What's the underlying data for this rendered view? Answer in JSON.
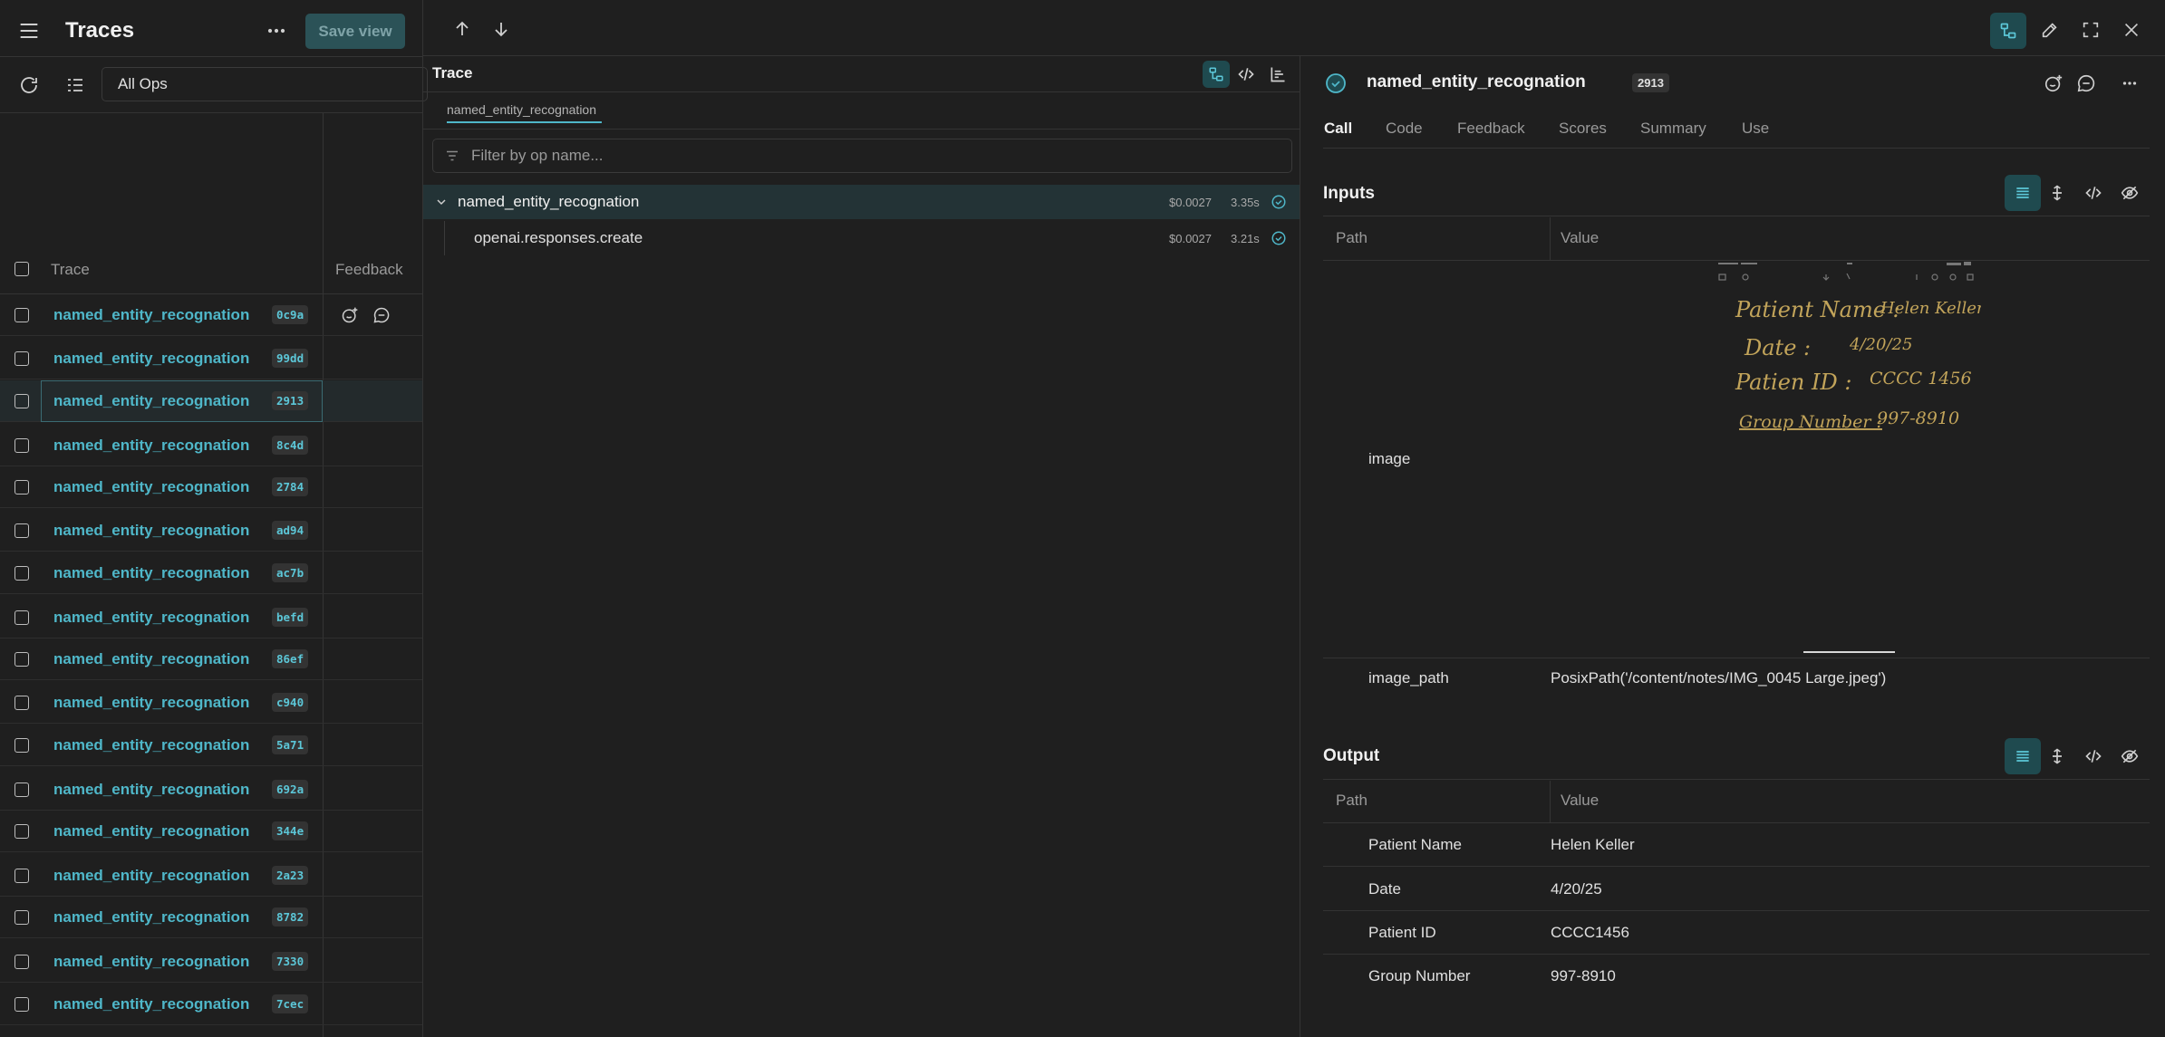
{
  "left": {
    "title": "Traces",
    "save_view": "Save view",
    "filter_select": "All Ops",
    "columns": {
      "trace": "Trace",
      "feedback": "Feedback"
    },
    "rows": [
      {
        "name": "named_entity_recognation",
        "id": "0c9a"
      },
      {
        "name": "named_entity_recognation",
        "id": "99dd"
      },
      {
        "name": "named_entity_recognation",
        "id": "2913"
      },
      {
        "name": "named_entity_recognation",
        "id": "8c4d"
      },
      {
        "name": "named_entity_recognation",
        "id": "2784"
      },
      {
        "name": "named_entity_recognation",
        "id": "ad94"
      },
      {
        "name": "named_entity_recognation",
        "id": "ac7b"
      },
      {
        "name": "named_entity_recognation",
        "id": "befd"
      },
      {
        "name": "named_entity_recognation",
        "id": "86ef"
      },
      {
        "name": "named_entity_recognation",
        "id": "c940"
      },
      {
        "name": "named_entity_recognation",
        "id": "5a71"
      },
      {
        "name": "named_entity_recognation",
        "id": "692a"
      },
      {
        "name": "named_entity_recognation",
        "id": "344e"
      },
      {
        "name": "named_entity_recognation",
        "id": "2a23"
      },
      {
        "name": "named_entity_recognation",
        "id": "8782"
      },
      {
        "name": "named_entity_recognation",
        "id": "7330"
      },
      {
        "name": "named_entity_recognation",
        "id": "7cec"
      }
    ]
  },
  "middle": {
    "title": "Trace",
    "breadcrumb": "named_entity_recognation",
    "filter_placeholder": "Filter by op name...",
    "tree": [
      {
        "name": "named_entity_recognation",
        "cost": "$0.0027",
        "time": "3.35s"
      },
      {
        "name": "openai.responses.create",
        "cost": "$0.0027",
        "time": "3.21s"
      }
    ]
  },
  "right": {
    "call_name": "named_entity_recognation",
    "call_id": "2913",
    "tabs": [
      "Call",
      "Code",
      "Feedback",
      "Scores",
      "Summary",
      "Use"
    ],
    "inputs": {
      "title": "Inputs",
      "path_header": "Path",
      "value_header": "Value",
      "image_label": "image",
      "image_path_label": "image_path",
      "image_path_value": "PosixPath('/content/notes/IMG_0045 Large.jpeg')",
      "handwriting": {
        "line1_label": "Patient Name :",
        "line1_value": "Helen Keller",
        "line2_label": "Date :",
        "line2_value": "4/20/25",
        "line3_label": "Patien ID :",
        "line3_value": "CCCC 1456",
        "line4_label": "Group Number :",
        "line4_value": "997-8910"
      }
    },
    "output": {
      "title": "Output",
      "path_header": "Path",
      "value_header": "Value",
      "rows": [
        {
          "path": "Patient Name",
          "value": "Helen Keller"
        },
        {
          "path": "Date",
          "value": "4/20/25"
        },
        {
          "path": "Patient ID",
          "value": "CCCC1456"
        },
        {
          "path": "Group Number",
          "value": "997-8910"
        }
      ]
    }
  },
  "colors": {
    "accent": "#4fb7c9",
    "accent_bg": "#1f4a4f",
    "background": "#1f1f1f"
  }
}
